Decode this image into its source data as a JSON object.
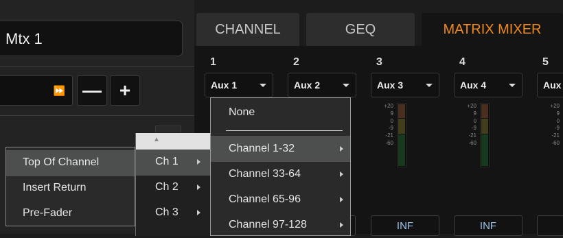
{
  "left": {
    "name_value": "Mtx 1",
    "nav_icon": "fast-forward-icon",
    "minus_label": "—",
    "plus_label": "+"
  },
  "tabs": [
    {
      "label": "CHANNEL"
    },
    {
      "label": "GEQ"
    },
    {
      "label": "MATRIX MIXER"
    }
  ],
  "accent_color": "#f08a1c",
  "columns": [
    {
      "number": "1",
      "aux": "Aux 1"
    },
    {
      "number": "2",
      "aux": "Aux 2"
    },
    {
      "number": "3",
      "aux": "Aux 3"
    },
    {
      "number": "4",
      "aux": "Aux 4"
    },
    {
      "number": "5",
      "aux": "Aux"
    }
  ],
  "meter_scale": [
    "+20",
    "9",
    "0",
    "-9",
    "-21",
    "-60"
  ],
  "inf_label": "INF",
  "tap_menu": {
    "items": [
      "Top Of Channel",
      "Insert Return",
      "Pre-Fader"
    ],
    "highlighted": "Top Of Channel"
  },
  "channel_menu": {
    "up_icon": "scroll-up-arrow-icon",
    "items": [
      "Ch 1",
      "Ch 2",
      "Ch 3"
    ],
    "highlighted": "Ch 1"
  },
  "source_menu": {
    "items": [
      "None",
      "Channel 1-32",
      "Channel 33-64",
      "Channel 65-96",
      "Channel 97-128"
    ],
    "highlighted": "Channel 1-32"
  }
}
